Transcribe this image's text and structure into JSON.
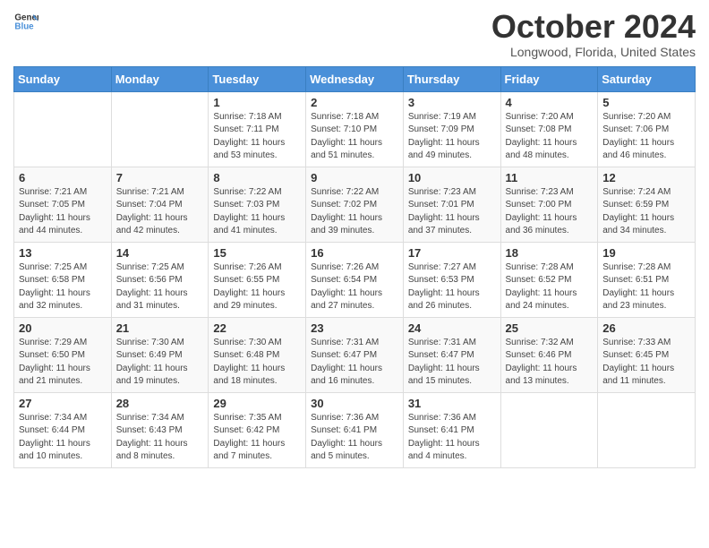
{
  "header": {
    "logo_general": "General",
    "logo_blue": "Blue",
    "month_title": "October 2024",
    "location": "Longwood, Florida, United States"
  },
  "days_of_week": [
    "Sunday",
    "Monday",
    "Tuesday",
    "Wednesday",
    "Thursday",
    "Friday",
    "Saturday"
  ],
  "weeks": [
    [
      {
        "day": "",
        "sunrise": "",
        "sunset": "",
        "daylight": ""
      },
      {
        "day": "",
        "sunrise": "",
        "sunset": "",
        "daylight": ""
      },
      {
        "day": "1",
        "sunrise": "Sunrise: 7:18 AM",
        "sunset": "Sunset: 7:11 PM",
        "daylight": "Daylight: 11 hours and 53 minutes."
      },
      {
        "day": "2",
        "sunrise": "Sunrise: 7:18 AM",
        "sunset": "Sunset: 7:10 PM",
        "daylight": "Daylight: 11 hours and 51 minutes."
      },
      {
        "day": "3",
        "sunrise": "Sunrise: 7:19 AM",
        "sunset": "Sunset: 7:09 PM",
        "daylight": "Daylight: 11 hours and 49 minutes."
      },
      {
        "day": "4",
        "sunrise": "Sunrise: 7:20 AM",
        "sunset": "Sunset: 7:08 PM",
        "daylight": "Daylight: 11 hours and 48 minutes."
      },
      {
        "day": "5",
        "sunrise": "Sunrise: 7:20 AM",
        "sunset": "Sunset: 7:06 PM",
        "daylight": "Daylight: 11 hours and 46 minutes."
      }
    ],
    [
      {
        "day": "6",
        "sunrise": "Sunrise: 7:21 AM",
        "sunset": "Sunset: 7:05 PM",
        "daylight": "Daylight: 11 hours and 44 minutes."
      },
      {
        "day": "7",
        "sunrise": "Sunrise: 7:21 AM",
        "sunset": "Sunset: 7:04 PM",
        "daylight": "Daylight: 11 hours and 42 minutes."
      },
      {
        "day": "8",
        "sunrise": "Sunrise: 7:22 AM",
        "sunset": "Sunset: 7:03 PM",
        "daylight": "Daylight: 11 hours and 41 minutes."
      },
      {
        "day": "9",
        "sunrise": "Sunrise: 7:22 AM",
        "sunset": "Sunset: 7:02 PM",
        "daylight": "Daylight: 11 hours and 39 minutes."
      },
      {
        "day": "10",
        "sunrise": "Sunrise: 7:23 AM",
        "sunset": "Sunset: 7:01 PM",
        "daylight": "Daylight: 11 hours and 37 minutes."
      },
      {
        "day": "11",
        "sunrise": "Sunrise: 7:23 AM",
        "sunset": "Sunset: 7:00 PM",
        "daylight": "Daylight: 11 hours and 36 minutes."
      },
      {
        "day": "12",
        "sunrise": "Sunrise: 7:24 AM",
        "sunset": "Sunset: 6:59 PM",
        "daylight": "Daylight: 11 hours and 34 minutes."
      }
    ],
    [
      {
        "day": "13",
        "sunrise": "Sunrise: 7:25 AM",
        "sunset": "Sunset: 6:58 PM",
        "daylight": "Daylight: 11 hours and 32 minutes."
      },
      {
        "day": "14",
        "sunrise": "Sunrise: 7:25 AM",
        "sunset": "Sunset: 6:56 PM",
        "daylight": "Daylight: 11 hours and 31 minutes."
      },
      {
        "day": "15",
        "sunrise": "Sunrise: 7:26 AM",
        "sunset": "Sunset: 6:55 PM",
        "daylight": "Daylight: 11 hours and 29 minutes."
      },
      {
        "day": "16",
        "sunrise": "Sunrise: 7:26 AM",
        "sunset": "Sunset: 6:54 PM",
        "daylight": "Daylight: 11 hours and 27 minutes."
      },
      {
        "day": "17",
        "sunrise": "Sunrise: 7:27 AM",
        "sunset": "Sunset: 6:53 PM",
        "daylight": "Daylight: 11 hours and 26 minutes."
      },
      {
        "day": "18",
        "sunrise": "Sunrise: 7:28 AM",
        "sunset": "Sunset: 6:52 PM",
        "daylight": "Daylight: 11 hours and 24 minutes."
      },
      {
        "day": "19",
        "sunrise": "Sunrise: 7:28 AM",
        "sunset": "Sunset: 6:51 PM",
        "daylight": "Daylight: 11 hours and 23 minutes."
      }
    ],
    [
      {
        "day": "20",
        "sunrise": "Sunrise: 7:29 AM",
        "sunset": "Sunset: 6:50 PM",
        "daylight": "Daylight: 11 hours and 21 minutes."
      },
      {
        "day": "21",
        "sunrise": "Sunrise: 7:30 AM",
        "sunset": "Sunset: 6:49 PM",
        "daylight": "Daylight: 11 hours and 19 minutes."
      },
      {
        "day": "22",
        "sunrise": "Sunrise: 7:30 AM",
        "sunset": "Sunset: 6:48 PM",
        "daylight": "Daylight: 11 hours and 18 minutes."
      },
      {
        "day": "23",
        "sunrise": "Sunrise: 7:31 AM",
        "sunset": "Sunset: 6:47 PM",
        "daylight": "Daylight: 11 hours and 16 minutes."
      },
      {
        "day": "24",
        "sunrise": "Sunrise: 7:31 AM",
        "sunset": "Sunset: 6:47 PM",
        "daylight": "Daylight: 11 hours and 15 minutes."
      },
      {
        "day": "25",
        "sunrise": "Sunrise: 7:32 AM",
        "sunset": "Sunset: 6:46 PM",
        "daylight": "Daylight: 11 hours and 13 minutes."
      },
      {
        "day": "26",
        "sunrise": "Sunrise: 7:33 AM",
        "sunset": "Sunset: 6:45 PM",
        "daylight": "Daylight: 11 hours and 11 minutes."
      }
    ],
    [
      {
        "day": "27",
        "sunrise": "Sunrise: 7:34 AM",
        "sunset": "Sunset: 6:44 PM",
        "daylight": "Daylight: 11 hours and 10 minutes."
      },
      {
        "day": "28",
        "sunrise": "Sunrise: 7:34 AM",
        "sunset": "Sunset: 6:43 PM",
        "daylight": "Daylight: 11 hours and 8 minutes."
      },
      {
        "day": "29",
        "sunrise": "Sunrise: 7:35 AM",
        "sunset": "Sunset: 6:42 PM",
        "daylight": "Daylight: 11 hours and 7 minutes."
      },
      {
        "day": "30",
        "sunrise": "Sunrise: 7:36 AM",
        "sunset": "Sunset: 6:41 PM",
        "daylight": "Daylight: 11 hours and 5 minutes."
      },
      {
        "day": "31",
        "sunrise": "Sunrise: 7:36 AM",
        "sunset": "Sunset: 6:41 PM",
        "daylight": "Daylight: 11 hours and 4 minutes."
      },
      {
        "day": "",
        "sunrise": "",
        "sunset": "",
        "daylight": ""
      },
      {
        "day": "",
        "sunrise": "",
        "sunset": "",
        "daylight": ""
      }
    ]
  ]
}
